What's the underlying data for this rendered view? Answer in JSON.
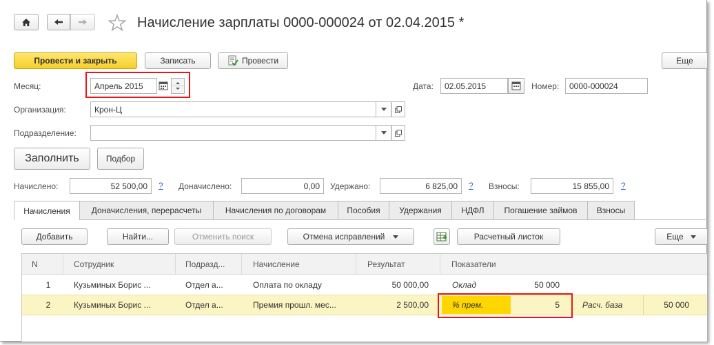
{
  "window": {
    "title": "Начисление зарплаты 0000-000024 от 02.04.2015 *"
  },
  "toolbar": {
    "post_close": "Провести и закрыть",
    "save": "Записать",
    "post": "Провести",
    "more": "Еще"
  },
  "header": {
    "month_label": "Месяц:",
    "month_value": "Апрель 2015",
    "date_label": "Дата:",
    "date_value": "02.05.2015",
    "number_label": "Номер:",
    "number_value": "0000-000024",
    "org_label": "Организация:",
    "org_value": "Крон-Ц",
    "dept_label": "Подразделение:",
    "dept_value": ""
  },
  "actions": {
    "fill": "Заполнить",
    "select": "Подбор"
  },
  "totals": {
    "accrued_label": "Начислено:",
    "accrued_value": "52 500,00",
    "additional_label": "Доначислено:",
    "additional_value": "0,00",
    "withheld_label": "Удержано:",
    "withheld_value": "6 825,00",
    "contributions_label": "Взносы:",
    "contributions_value": "15 855,00",
    "help": "?"
  },
  "tabs": [
    "Начисления",
    "Доначисления, перерасчеты",
    "Начисления по договорам",
    "Пособия",
    "Удержания",
    "НДФЛ",
    "Погашение займов",
    "Взносы"
  ],
  "table_toolbar": {
    "add": "Добавить",
    "find": "Найти...",
    "cancel_search": "Отменить поиск",
    "cancel_corrections": "Отмена исправлений",
    "payslip": "Расчетный листок",
    "more": "Еще"
  },
  "table": {
    "columns": [
      "N",
      "Сотрудник",
      "Подразд...",
      "Начисление",
      "Результат",
      "Показатели"
    ],
    "rows": [
      {
        "n": "1",
        "employee": "Кузьминых Борис ...",
        "dept": "Отдел а...",
        "accrual": "Оплата по окладу",
        "result": "50 000,00",
        "ind1_name": "Оклад",
        "ind1_value": "50 000",
        "ind2_name": "",
        "ind2_value": ""
      },
      {
        "n": "2",
        "employee": "Кузьминых Борис ...",
        "dept": "Отдел а...",
        "accrual": "Премия прошл. мес...",
        "result": "2 500,00",
        "ind1_name": "% прем.",
        "ind1_value": "5",
        "ind2_name": "Расч. база",
        "ind2_value": "50 000"
      }
    ]
  },
  "colors": {
    "primary_button": "#f5cf2a",
    "selected_row": "#fbf5c4",
    "edit_cell": "#ffd600",
    "highlight_frame": "#e8161b",
    "link": "#3a67c7"
  }
}
